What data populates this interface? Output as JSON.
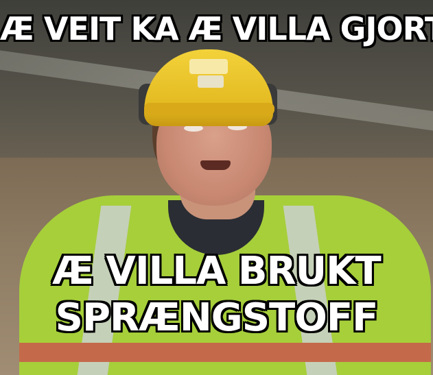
{
  "meme": {
    "top_text": "Æ VEIT KA Æ VILLA GJORT",
    "bottom_line_1": "Æ VILLA BRUKT",
    "bottom_line_2": "SPRÆNGSTOFF"
  },
  "colors": {
    "caption_fill": "#ffffff",
    "caption_outline": "#000000",
    "vest": "#a6cf3a",
    "helmet": "#f3d23a"
  }
}
